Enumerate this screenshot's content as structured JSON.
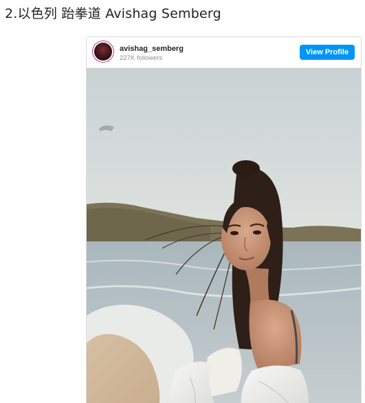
{
  "article": {
    "heading": "2.以色列 跆拳道 Avishag Semberg"
  },
  "embed": {
    "username": "avishag_semberg",
    "followers": "227K followers",
    "view_profile_label": "View Profile",
    "accent_color": "#0095f6"
  },
  "icons": {
    "avatar": "profile-avatar"
  },
  "photo": {
    "description_icon": "beach-portrait-photo"
  }
}
